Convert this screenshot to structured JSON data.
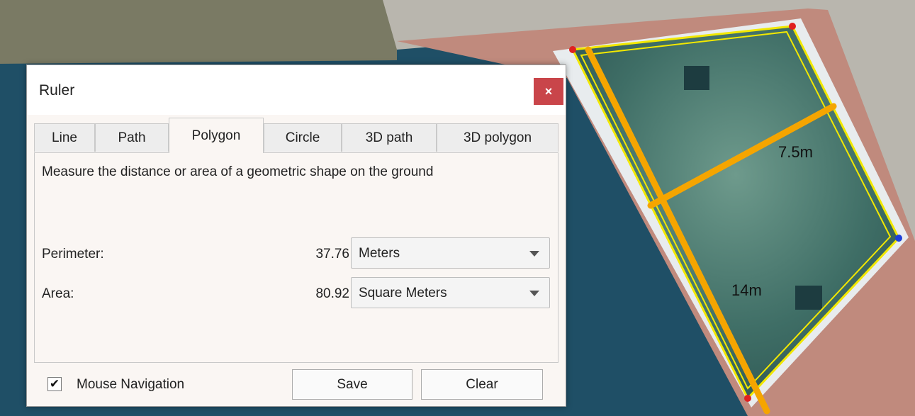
{
  "map": {
    "measure_labels": [
      {
        "text": "7.5m"
      },
      {
        "text": "14m"
      }
    ]
  },
  "dialog": {
    "title": "Ruler",
    "close_glyph": "×",
    "tabs": [
      {
        "label": "Line",
        "active": false
      },
      {
        "label": "Path",
        "active": false
      },
      {
        "label": "Polygon",
        "active": true
      },
      {
        "label": "Circle",
        "active": false
      },
      {
        "label": "3D path",
        "active": false
      },
      {
        "label": "3D polygon",
        "active": false
      }
    ],
    "description": "Measure the distance or area of a geometric shape on the ground",
    "perimeter": {
      "label": "Perimeter:",
      "value": "37.76",
      "unit": "Meters"
    },
    "area": {
      "label": "Area:",
      "value": "80.92",
      "unit": "Square Meters"
    },
    "mouse_navigation": {
      "label": "Mouse Navigation",
      "checked": true,
      "check_glyph": "✔"
    },
    "save_label": "Save",
    "clear_label": "Clear"
  },
  "colors": {
    "water": "#1f4f66",
    "pool": "#3d6b66",
    "measure_line": "#f5a500",
    "polygon_outline": "#f2e800",
    "close_button": "#c9454a"
  }
}
